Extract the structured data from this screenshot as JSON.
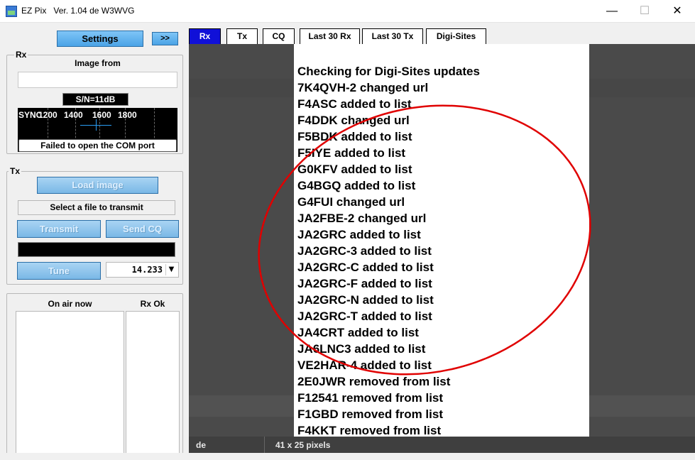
{
  "window": {
    "app_name": "EZ Pix",
    "version": "Ver. 1.04 de W3WVG",
    "minimize": "—",
    "maximize": "☐",
    "close": "✕"
  },
  "left": {
    "settings_label": "Settings",
    "expand_label": ">>",
    "rx": {
      "group_label": "Rx",
      "image_from_label": "Image from",
      "image_from_value": "",
      "snr": "S/N=11dB",
      "scope_labels": [
        "SYNC",
        "1200",
        "1400",
        "1600",
        "1800"
      ],
      "error": "Failed to open the COM port"
    },
    "tx": {
      "group_label": "Tx",
      "load_image": "Load image",
      "select_file": "Select a file to transmit",
      "transmit": "Transmit",
      "send_cq": "Send CQ",
      "tune": "Tune",
      "frequency": "14.233"
    },
    "onair": {
      "on_air_header": "On air now",
      "rx_ok_header": "Rx Ok"
    }
  },
  "tabs": [
    "Rx",
    "Tx",
    "CQ",
    "Last 30 Rx",
    "Last 30 Tx",
    "Digi-Sites"
  ],
  "active_tab": "Rx",
  "log": [
    "Checking for Digi-Sites updates",
    "7K4QVH-2 changed url",
    "F4ASC added to list",
    "F4DDK changed url",
    "F5BDK added to list",
    "F5IYE added to list",
    "G0KFV added to list",
    "G4BGQ added to list",
    "G4FUI changed url",
    "JA2FBE-2 changed url",
    "JA2GRC added to list",
    "JA2GRC-3 added to list",
    "JA2GRC-C added to list",
    "JA2GRC-F added to list",
    "JA2GRC-N added to list",
    "JA2GRC-T added to list",
    "JA4CRT added to list",
    "JA6LNC3 added to list",
    "VE2HAR-4 added to list",
    "2E0JWR removed from list",
    "F12541 removed from list",
    "F1GBD removed from list",
    "F4KKT removed from list"
  ],
  "status": {
    "left": "de",
    "size": "41 x 25 pixels"
  },
  "colors": {
    "accent_button": "#4aa3e6",
    "active_tab": "#1010d8",
    "annotation": "#e00000"
  }
}
